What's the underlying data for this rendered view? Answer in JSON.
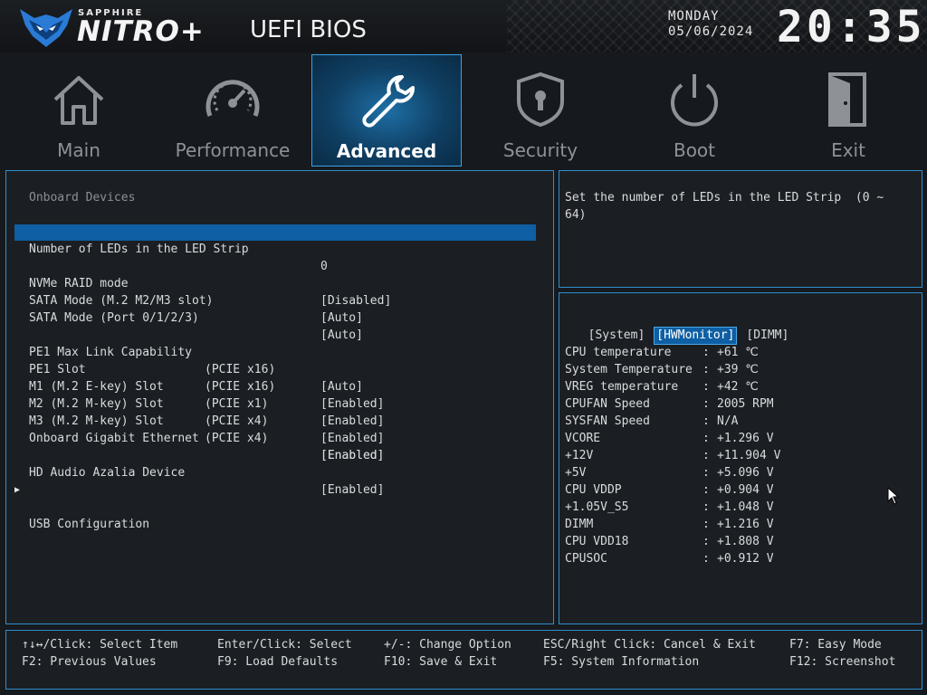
{
  "header": {
    "brand_small": "SAPPHIRE",
    "brand_big": "NITRO+",
    "title": "UEFI BIOS",
    "day": "MONDAY",
    "date": "05/06/2024",
    "clock": "20:35"
  },
  "tabs": [
    {
      "label": "Main",
      "icon": "home-icon"
    },
    {
      "label": "Performance",
      "icon": "gauge-icon"
    },
    {
      "label": "Advanced",
      "icon": "wrench-icon",
      "active": true
    },
    {
      "label": "Security",
      "icon": "shield-lock-icon"
    },
    {
      "label": "Boot",
      "icon": "power-icon"
    },
    {
      "label": "Exit",
      "icon": "door-icon"
    }
  ],
  "settings": {
    "section_title": "Onboard Devices",
    "items": [
      {
        "label": "Number of LEDs in the LED Strip",
        "sub": "",
        "value": "0"
      },
      {
        "label": "NVMe RAID mode",
        "sub": "",
        "value": "[Disabled]"
      },
      {
        "label": "SATA Mode (M.2 M2/M3 slot)",
        "sub": "",
        "value": "[Auto]"
      },
      {
        "label": "SATA Mode (Port 0/1/2/3)",
        "sub": "",
        "value": "[Auto]"
      },
      {
        "label": "PE1 Max Link Capability",
        "sub": "(PCIE x16)",
        "value": "[Auto]"
      },
      {
        "label": "PE1 Slot",
        "sub": "(PCIE x16)",
        "value": "[Enabled]"
      },
      {
        "label": "M1 (M.2 E-key) Slot",
        "sub": "(PCIE x1)",
        "value": "[Enabled]"
      },
      {
        "label": "M2 (M.2 M-key) Slot",
        "sub": "(PCIE x4)",
        "value": "[Enabled]"
      },
      {
        "label": "M3 (M.2 M-key) Slot",
        "sub": "(PCIE x4)",
        "value": "[Enabled]"
      },
      {
        "label": "Onboard Gigabit Ethernet",
        "sub": "",
        "value": "[Enabled]"
      },
      {
        "label": "HD Audio Azalia Device",
        "sub": "",
        "value": "[Enabled]"
      },
      {
        "label": "USB Configuration",
        "sub": "",
        "value": ""
      }
    ]
  },
  "help": {
    "text_line1": "Set the number of LEDs in the LED Strip  (0 ~",
    "text_line2": "64)"
  },
  "hwmonitor": {
    "tabs": [
      "[System]",
      "[HWMonitor]",
      "[DIMM]"
    ],
    "sep": ":",
    "rows": [
      {
        "key": "CPU temperature",
        "value": "+61 ℃"
      },
      {
        "key": "System Temperature",
        "value": "+39 ℃"
      },
      {
        "key": "VREG temperature",
        "value": "+42 ℃"
      },
      {
        "key": "CPUFAN Speed",
        "value": "2005 RPM"
      },
      {
        "key": "SYSFAN Speed",
        "value": "N/A"
      },
      {
        "key": "VCORE",
        "value": "+1.296 V"
      },
      {
        "key": "+12V",
        "value": "+11.904 V"
      },
      {
        "key": "+5V",
        "value": "+5.096 V"
      },
      {
        "key": "CPU VDDP",
        "value": "+0.904 V"
      },
      {
        "key": "+1.05V_S5",
        "value": "+1.048 V"
      },
      {
        "key": "DIMM",
        "value": "+1.216 V"
      },
      {
        "key": "CPU VDD18",
        "value": "+1.808 V"
      },
      {
        "key": "CPUSOC",
        "value": "+0.912 V"
      }
    ]
  },
  "footer": {
    "hints": [
      "↑↓↔/Click: Select Item",
      "Enter/Click: Select",
      "+/-: Change Option",
      "ESC/Right Click: Cancel & Exit",
      "F7: Easy Mode",
      "F2: Previous Values",
      "F9: Load Defaults",
      "F10: Save & Exit",
      "F5: System Information",
      "F12: Screenshot"
    ]
  }
}
